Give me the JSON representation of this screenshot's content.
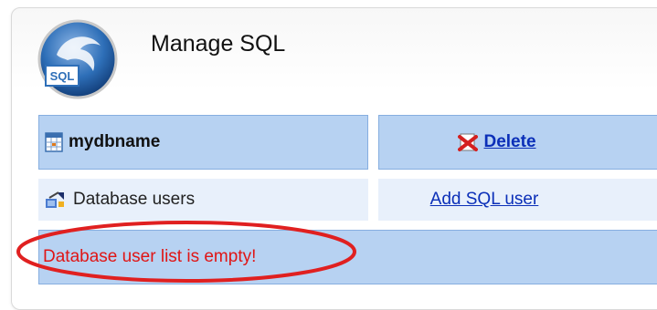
{
  "header": {
    "title": "Manage SQL",
    "logo_text": "SQL",
    "logo_icon": "mysql-dolphin-logo"
  },
  "database": {
    "name": "mydbname",
    "name_icon": "database-table-icon",
    "delete_label": "Delete",
    "delete_icon": "delete-icon"
  },
  "users_row": {
    "label": "Database users",
    "label_icon": "database-users-icon",
    "add_label": "Add SQL user"
  },
  "message": {
    "text": "Database user list is empty!",
    "highlight_color": "#e02020"
  },
  "colors": {
    "header_row": "#b7d2f2",
    "light_row": "#e8f0fb",
    "link": "#0b2fb8",
    "error": "#e01515"
  }
}
